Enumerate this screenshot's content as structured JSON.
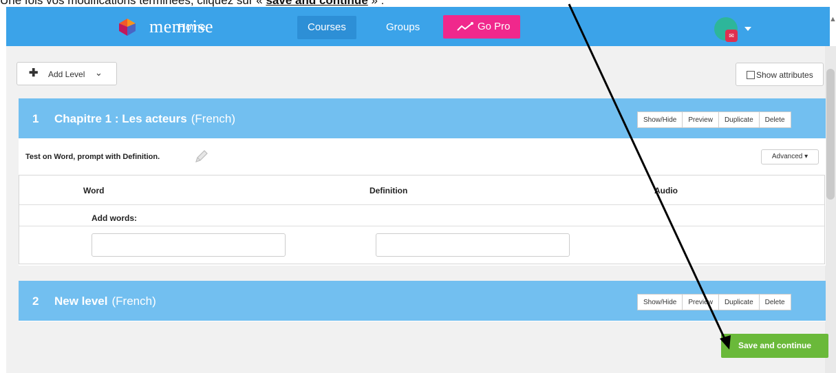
{
  "caption": {
    "text_before": "Une fois vos modifications terminées, cliquez sur « ",
    "highlight": "save and continue",
    "text_after": " » :"
  },
  "navbar": {
    "logo": "memrise",
    "items": [
      {
        "label": "Home"
      },
      {
        "label": "Courses",
        "active": true
      },
      {
        "label": "Groups"
      }
    ],
    "gopro_label": "Go Pro",
    "colors": {
      "bar": "#3ba3e9",
      "gopro": "#f0288c",
      "active": "#2d8fd6"
    }
  },
  "toolbar": {
    "add_level_label": "Add Level",
    "show_attributes_label": "Show attributes",
    "show_attributes_checked": false
  },
  "levels": [
    {
      "number": "1",
      "title": "Chapitre 1 : Les acteurs",
      "language": "(French)",
      "buttons": [
        "Show/Hide",
        "Preview",
        "Duplicate",
        "Delete"
      ],
      "test_line": "Test on Word, prompt with Definition.",
      "advanced_label": "Advanced",
      "columns": [
        "Word",
        "Definition",
        "Audio"
      ],
      "add_words_label": "Add words:",
      "inputs": [
        {
          "value": ""
        },
        {
          "value": ""
        }
      ]
    },
    {
      "number": "2",
      "title": "New level",
      "language": "(French)",
      "buttons": [
        "Show/Hide",
        "Preview",
        "Duplicate",
        "Delete"
      ]
    }
  ],
  "save_button_label": "Save and continue",
  "colors": {
    "level_header": "#72bff0",
    "save": "#6ab93a"
  }
}
